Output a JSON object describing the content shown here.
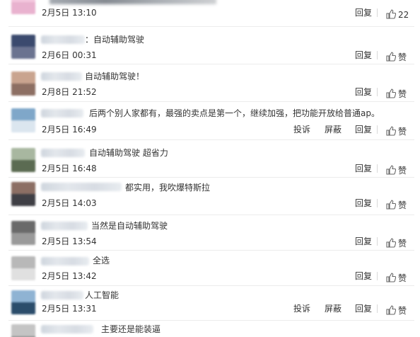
{
  "actions": {
    "reply": "回复",
    "report": "投诉",
    "block": "屏蔽",
    "like": "赞"
  },
  "comments": [
    {
      "text": "",
      "time": "2月5日 13:10",
      "likes": "22",
      "avatar_colors": [
        "#f3c8de",
        "#e9b2cf"
      ]
    },
    {
      "text": "：自动辅助驾驶",
      "time": "2月6日 00:31",
      "likes": "赞",
      "avatar_colors": [
        "#3b4a6e",
        "#6b7390"
      ]
    },
    {
      "text": "自动辅助驾驶！",
      "time": "2月8日 21:52",
      "likes": "赞",
      "avatar_colors": [
        "#c9a48f",
        "#8d6f63"
      ]
    },
    {
      "text": "后两个别人家都有，最强的卖点是第一个，继续加强，把功能开放给普通ap。",
      "time": "2月5日 16:49",
      "likes": "赞",
      "avatar_colors": [
        "#7fa7c9",
        "#dbe6ef"
      ]
    },
    {
      "text": "自动辅助驾驶 超省力",
      "time": "2月5日 16:48",
      "likes": "赞",
      "avatar_colors": [
        "#a8b7a0",
        "#5b6b52"
      ]
    },
    {
      "text": "都实用，我吹爆特斯拉",
      "time": "2月5日 14:03",
      "likes": "赞",
      "avatar_colors": [
        "#8c6f64",
        "#3f3f45"
      ]
    },
    {
      "text": "当然是自动辅助驾驶",
      "time": "2月5日 13:54",
      "likes": "赞",
      "avatar_colors": [
        "#6a6a6a",
        "#9a9a9a"
      ]
    },
    {
      "text": "全选",
      "time": "2月5日 13:42",
      "likes": "赞",
      "avatar_colors": [
        "#b8b8b8",
        "#e0e0e0"
      ]
    },
    {
      "text": "人工智能",
      "time": "2月5日 13:31",
      "likes": "赞",
      "avatar_colors": [
        "#8fb3d3",
        "#2b4d6b"
      ]
    },
    {
      "text": "主要还是能装逼",
      "time": "",
      "likes": "",
      "avatar_colors": [
        "#c4c4c4",
        "#8f8f8f"
      ]
    }
  ]
}
